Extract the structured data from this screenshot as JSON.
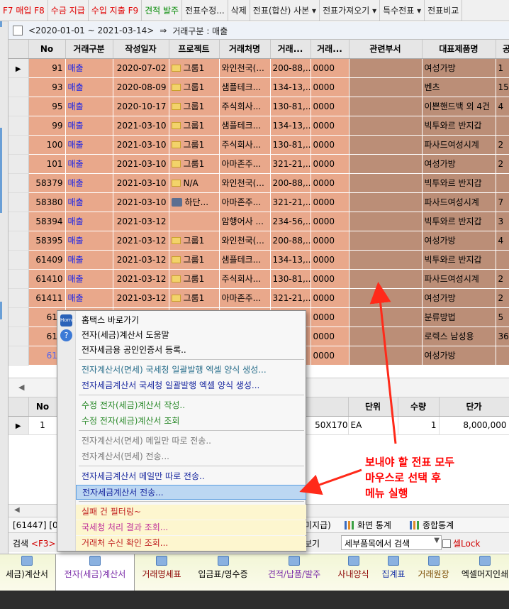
{
  "topbar": {
    "items": [
      {
        "label": "F7 매입 F8",
        "color": "red"
      },
      {
        "label": "수금 지급",
        "color": "red"
      },
      {
        "label": "수입 지출 F9",
        "color": "red"
      },
      {
        "label": "견적 발주",
        "color": "green"
      },
      {
        "label": "전표수정...",
        "color": "black"
      },
      {
        "label": "삭제",
        "color": "black"
      },
      {
        "label": "전표(합산) 사본 ▾",
        "color": "black"
      },
      {
        "label": "전표가져오기 ▾",
        "color": "black"
      },
      {
        "label": "특수전표 ▾",
        "color": "black"
      },
      {
        "label": "전표비교",
        "color": "black"
      }
    ]
  },
  "filter": {
    "range": "<2020-01-01 ~ 2021-03-14>",
    "arrow": "⇒",
    "condition": "거래구분 : 매출"
  },
  "grid": {
    "columns": [
      "No",
      "거래구분",
      "작성일자",
      "프로젝트",
      "거래처명",
      "거래...",
      "거래...",
      "관련부서",
      "대표제품명",
      "공"
    ],
    "rows": [
      {
        "no": "91",
        "kind": "매출",
        "date": "2020-07-02",
        "project": "그룹1",
        "project_icon": "folder",
        "client": "와인천국(...",
        "biz": "200-88,...",
        "code": "0000",
        "dept": "",
        "product": "여성가방",
        "extra": "1"
      },
      {
        "no": "93",
        "kind": "매출",
        "date": "2020-08-09",
        "project": "그룹1",
        "project_icon": "folder",
        "client": "샘플테크...",
        "biz": "134-13,...",
        "code": "0000",
        "dept": "",
        "product": "벤츠",
        "extra": "15"
      },
      {
        "no": "95",
        "kind": "매출",
        "date": "2020-10-17",
        "project": "그룹1",
        "project_icon": "folder",
        "client": "주식회사...",
        "biz": "130-81,...",
        "code": "0000",
        "dept": "",
        "product": "이쁜핸드백 외 4건",
        "extra": "4"
      },
      {
        "no": "99",
        "kind": "매출",
        "date": "2021-03-10",
        "project": "그룹1",
        "project_icon": "folder",
        "client": "샘플테크...",
        "biz": "134-13,...",
        "code": "0000",
        "dept": "",
        "product": "빅투와르 반지갑",
        "extra": ""
      },
      {
        "no": "100",
        "kind": "매출",
        "date": "2021-03-10",
        "project": "그룹1",
        "project_icon": "folder",
        "client": "주식회사...",
        "biz": "130-81,...",
        "code": "0000",
        "dept": "",
        "product": "파사드여성시계",
        "extra": "2"
      },
      {
        "no": "101",
        "kind": "매출",
        "date": "2021-03-10",
        "project": "그룹1",
        "project_icon": "folder",
        "client": "아마존주...",
        "biz": "321-21,...",
        "code": "0000",
        "dept": "",
        "product": "여성가방",
        "extra": "2"
      },
      {
        "no": "58379",
        "kind": "매출",
        "date": "2021-03-10",
        "project": "N/A",
        "project_icon": "folder",
        "client": "와인천국(...",
        "biz": "200-88,...",
        "code": "0000",
        "dept": "",
        "product": "빅투와르 반지갑",
        "extra": ""
      },
      {
        "no": "58380",
        "kind": "매출",
        "date": "2021-03-10",
        "project": "하단...",
        "project_icon": "printer",
        "client": "아마존주...",
        "biz": "321-21,...",
        "code": "0000",
        "dept": "",
        "product": "파사드여성시계",
        "extra": "7"
      },
      {
        "no": "58394",
        "kind": "매출",
        "date": "2021-03-12",
        "project": "",
        "project_icon": "",
        "client": "암행어사 ...",
        "biz": "234-56,...",
        "code": "0000",
        "dept": "",
        "product": "빅투와르 반지갑",
        "extra": "3"
      },
      {
        "no": "58395",
        "kind": "매출",
        "date": "2021-03-12",
        "project": "그룹1",
        "project_icon": "folder",
        "client": "와인천국(...",
        "biz": "200-88,...",
        "code": "0000",
        "dept": "",
        "product": "여성가방",
        "extra": "4"
      },
      {
        "no": "61409",
        "kind": "매출",
        "date": "2021-03-12",
        "project": "그룹1",
        "project_icon": "folder",
        "client": "샘플테크...",
        "biz": "134-13,...",
        "code": "0000",
        "dept": "",
        "product": "빅투와르 반지갑",
        "extra": ""
      },
      {
        "no": "61410",
        "kind": "매출",
        "date": "2021-03-12",
        "project": "그룹1",
        "project_icon": "folder",
        "client": "주식회사...",
        "biz": "130-81,...",
        "code": "0000",
        "dept": "",
        "product": "파사드여성시계",
        "extra": "2"
      },
      {
        "no": "61411",
        "kind": "매출",
        "date": "2021-03-12",
        "project": "그룹1",
        "project_icon": "folder",
        "client": "아마존주...",
        "biz": "321-21,...",
        "code": "0000",
        "dept": "",
        "product": "여성가방",
        "extra": "2"
      },
      {
        "no": "614",
        "kind": "",
        "date": "",
        "project": "",
        "project_icon": "",
        "client": "",
        "biz": "",
        "code": "0000",
        "dept": "",
        "product": "분류방법",
        "extra": "5"
      },
      {
        "no": "614",
        "kind": "",
        "date": "",
        "project": "",
        "project_icon": "",
        "client": "",
        "biz": "",
        "code": "0000",
        "dept": "",
        "product": "로렉스 남성용",
        "extra": "36"
      },
      {
        "no": "614",
        "kind": "",
        "date": "",
        "project": "",
        "project_icon": "",
        "client": "",
        "biz": "",
        "code": "0000",
        "dept": "",
        "product": "여성가방",
        "extra": ""
      }
    ]
  },
  "detail": {
    "columns": [
      "No",
      "",
      "단위",
      "수량",
      "단가"
    ],
    "row": {
      "no": "1",
      "spec": "50X170",
      "unit": "EA",
      "qty": "1",
      "price": "8,000,000"
    }
  },
  "status": {
    "left": "[61447] [0",
    "unpaid": "미지급)",
    "screen_stats": "화면 통계",
    "total_stats": "종합통계"
  },
  "searchrow": {
    "label": "검색",
    "key": "<F3>",
    "view": "보기",
    "combo": "세부품목에서 검색",
    "lock": "셀Lock"
  },
  "bottomtabs": [
    {
      "label": "세금)계산서",
      "color": "plain"
    },
    {
      "label": "전자(세금)계산서",
      "color": "purple",
      "active": true
    },
    {
      "label": "거래명세표",
      "color": "darkred"
    },
    {
      "label": "입금표/영수증",
      "color": "plain"
    },
    {
      "label": "견적/납품/발주",
      "color": "purple"
    },
    {
      "label": "사내양식",
      "color": "darkred"
    },
    {
      "label": "집계표",
      "color": "blue"
    },
    {
      "label": "거래원장",
      "color": "brown"
    },
    {
      "label": "엑셀머지인쇄",
      "color": "plain"
    }
  ],
  "menu": {
    "items": [
      {
        "label": "홈택스 바로가기",
        "style": "black",
        "icon": "home-icon",
        "icon_text": "Home"
      },
      {
        "label": "전자(세금)계산서 도움말",
        "style": "black",
        "icon": "help-icon",
        "icon_text": "?"
      },
      {
        "label": "전자세금용 공인인증서 등록..",
        "style": "black"
      },
      {
        "label": "전자계산서(면세) 국세청 일괄발행 엑셀 양식 생성...",
        "style": "teal"
      },
      {
        "label": "전자세금계산서 국세청 일괄발행 엑셀 양식 생성...",
        "style": "navy"
      },
      {
        "label": "수정 전자(세금)계산서 작성..",
        "style": "green"
      },
      {
        "label": "수정 전자(세금)계산서 조회",
        "style": "green"
      },
      {
        "label": "전자계산서(면세) 메일만 따로 전송..",
        "style": "gray"
      },
      {
        "label": "전자계산서(면세) 전송...",
        "style": "gray"
      },
      {
        "label": "전자세금계산서 메일만 따로 전송..",
        "style": "navy2"
      },
      {
        "label": "전자세금계산서 전송...",
        "style": "hl"
      },
      {
        "label": "실패 건 필터링~",
        "style": "peach"
      },
      {
        "label": "국세청 처리 결과 조회...",
        "style": "pink"
      },
      {
        "label": "거래처 수신 확인 조회...",
        "style": "red2"
      }
    ]
  },
  "annotation": {
    "lines": [
      "보내야 할 전표 모두",
      "마우스로 선택 후",
      "메뉴 실행"
    ],
    "color": "#ff0000"
  },
  "colors": {
    "row_light": "#e9a88b",
    "row_dark": "#bb8e77",
    "kind_text": "#1a24e8",
    "menu_highlight": "#bcd7f2"
  }
}
